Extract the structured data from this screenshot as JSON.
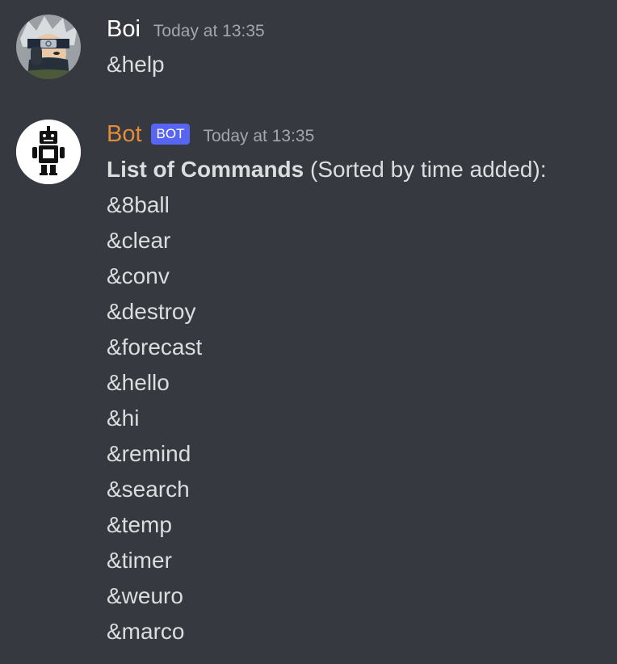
{
  "messages": [
    {
      "author": "Boi",
      "timestamp": "Today at 13:35",
      "avatar_icon": "ninja-avatar-icon",
      "text": "&help"
    },
    {
      "author": "Bot",
      "badge": "BOT",
      "timestamp": "Today at 13:35",
      "avatar_icon": "robot-avatar-icon",
      "heading_bold": "List of Commands",
      "heading_rest": " (Sorted by time added):",
      "commands": [
        "&8ball",
        "&clear",
        "&conv",
        "&destroy",
        "&forecast",
        "&hello",
        "&hi",
        "&remind",
        "&search",
        "&temp",
        "&timer",
        "&weuro",
        "&marco"
      ]
    }
  ],
  "colors": {
    "background": "#36393f",
    "bot_name": "#e28b3a",
    "bot_badge": "#5865f2",
    "text": "#dcddde",
    "timestamp": "#a3a6aa"
  }
}
